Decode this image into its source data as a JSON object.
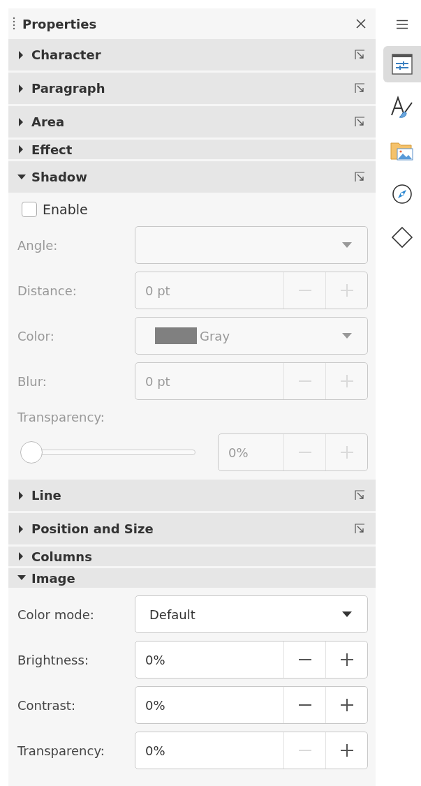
{
  "panel": {
    "title": "Properties"
  },
  "sections": [
    {
      "title": "Character",
      "expanded": false,
      "has_options": true
    },
    {
      "title": "Paragraph",
      "expanded": false,
      "has_options": true
    },
    {
      "title": "Area",
      "expanded": false,
      "has_options": true
    },
    {
      "title": "Effect",
      "expanded": false,
      "has_options": false
    },
    {
      "title": "Shadow",
      "expanded": true,
      "has_options": true,
      "controls": [
        {
          "kind": "checkbox",
          "label": "Enable",
          "checked": false,
          "disabled": false
        },
        {
          "kind": "dropdown",
          "label": "Angle:",
          "disabled": true
        },
        {
          "kind": "spin",
          "label": "Distance:",
          "value": "0 pt",
          "disabled": true,
          "minus_disabled": true
        },
        {
          "kind": "color",
          "label": "Color:",
          "value": "Gray",
          "color": "#808080",
          "disabled": true
        },
        {
          "kind": "spin",
          "label": "Blur:",
          "value": "0 pt",
          "disabled": true,
          "minus_disabled": true
        },
        {
          "kind": "caption",
          "label": "Transparency:",
          "disabled": true
        },
        {
          "kind": "slider",
          "level": 0,
          "value": "0%",
          "disabled": true,
          "minus_disabled": true
        }
      ]
    },
    {
      "title": "Line",
      "expanded": false,
      "has_options": true
    },
    {
      "title": "Position and Size",
      "expanded": false,
      "has_options": true
    },
    {
      "title": "Columns",
      "expanded": false,
      "has_options": false
    },
    {
      "title": "Image",
      "expanded": true,
      "has_options": false,
      "controls": [
        {
          "kind": "dropdown",
          "label": "Color mode:",
          "value": "Default",
          "disabled": false
        },
        {
          "kind": "spin",
          "label": "Brightness:",
          "value": "0%",
          "disabled": false,
          "minus_disabled": false
        },
        {
          "kind": "spin",
          "label": "Contrast:",
          "value": "0%",
          "disabled": false,
          "minus_disabled": false
        },
        {
          "kind": "spin",
          "label": "Transparency:",
          "value": "0%",
          "disabled": false,
          "minus_disabled": true
        }
      ]
    }
  ],
  "sidebar": {
    "tabs": [
      {
        "kind": "menu",
        "selected": false
      },
      {
        "kind": "properties",
        "selected": true
      },
      {
        "kind": "styles",
        "selected": false
      },
      {
        "kind": "gallery",
        "selected": false
      },
      {
        "kind": "navigator",
        "selected": false
      },
      {
        "kind": "shapes",
        "selected": false
      }
    ]
  }
}
